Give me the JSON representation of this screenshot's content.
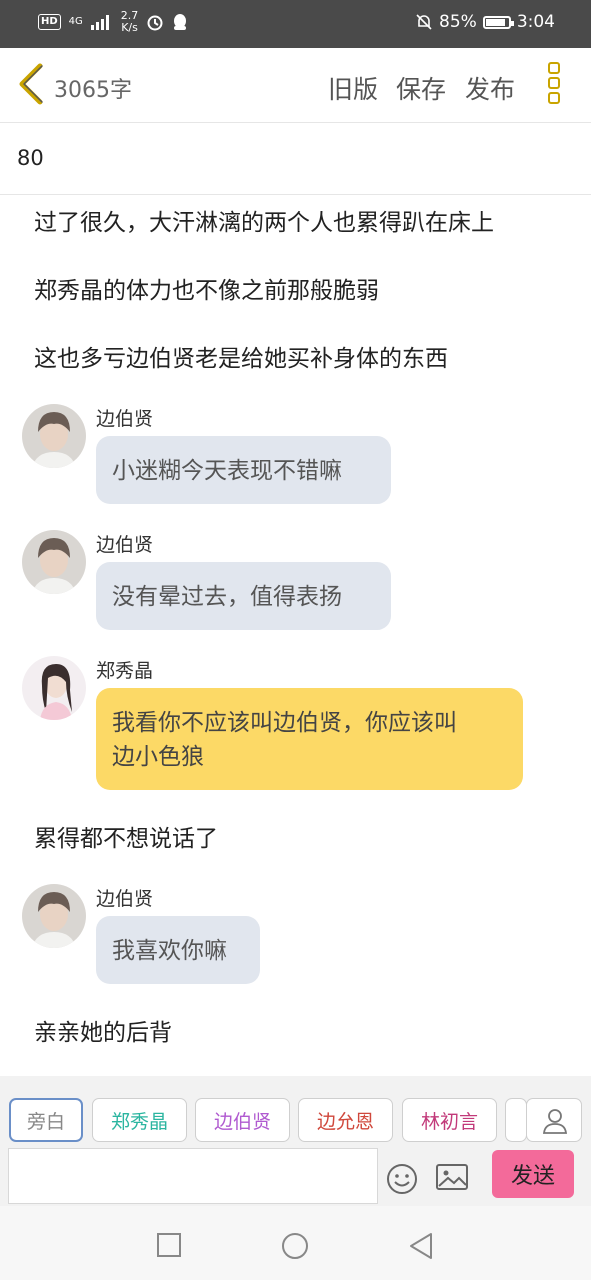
{
  "status": {
    "hd": "HD",
    "network": "4G",
    "speed_value": "2.7",
    "speed_unit": "K/s",
    "battery": "85%",
    "time": "3:04"
  },
  "header": {
    "word_count": "3065字",
    "old_version": "旧版",
    "save": "保存",
    "publish": "发布"
  },
  "meta_value": "80",
  "story": {
    "narration_1": "过了很久，大汗淋漓的两个人也累得趴在床上",
    "narration_2": "郑秀晶的体力也不像之前那般脆弱",
    "narration_3": "这也多亏边伯贤老是给她买补身体的东西",
    "msg_1": {
      "name": "边伯贤",
      "text": "小迷糊今天表现不错嘛"
    },
    "msg_2": {
      "name": "边伯贤",
      "text": "没有晕过去，值得表扬"
    },
    "msg_3": {
      "name": "郑秀晶",
      "line1": "我看你不应该叫边伯贤，你应该叫",
      "line2": "边小色狼"
    },
    "narration_4": "累得都不想说话了",
    "msg_4": {
      "name": "边伯贤",
      "text": "我喜欢你嘛"
    },
    "narration_5": "亲亲她的后背"
  },
  "composer": {
    "tags": [
      "旁白",
      "郑秀晶",
      "边伯贤",
      "边允恩",
      "林初言"
    ],
    "tag_colors": [
      "#888888",
      "#2bb5a0",
      "#b05ad0",
      "#d0483c",
      "#c23a7a"
    ],
    "send": "发送"
  },
  "colors": {
    "bubble_other": "#e1e6ee",
    "bubble_self": "#fcd966",
    "send_button": "#f36a9a",
    "accent_icon": "#c9a400"
  }
}
